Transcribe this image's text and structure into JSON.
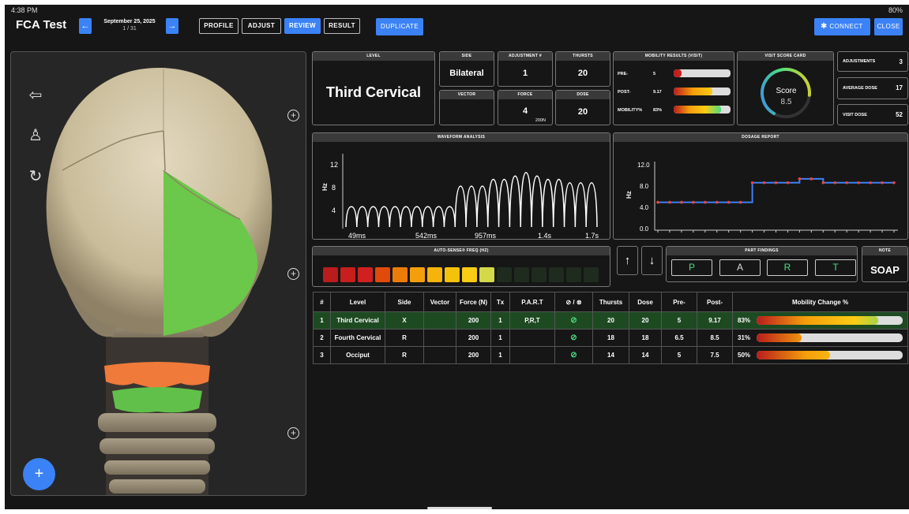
{
  "status": {
    "time": "4:38 PM",
    "battery": "80%"
  },
  "header": {
    "title": "FCA Test",
    "date": "September 25, 2025",
    "date_sub": "1 / 31",
    "tabs": [
      "PROFILE",
      "ADJUST",
      "REVIEW",
      "RESULT"
    ],
    "active_tab": "REVIEW",
    "duplicate_label": "DUPLICATE",
    "connect_label": "CONNECT",
    "close_label": "CLOSE"
  },
  "icons": {
    "prev": "arrow-left-icon",
    "next": "arrow-right-icon",
    "bluetooth": "bluetooth-icon",
    "share": "share-icon",
    "body": "body-icon",
    "refresh": "refresh-icon",
    "add": "plus-icon"
  },
  "level_card": {
    "header": "LEVEL",
    "value": "Third Cervical"
  },
  "side_card": {
    "header": "SIDE",
    "value": "Bilateral"
  },
  "adjustment_card": {
    "header": "ADJUSTMENT #",
    "value": "1"
  },
  "thursts_card": {
    "header": "THURSTS",
    "value": "20"
  },
  "vector_card": {
    "header": "VECTOR",
    "value": ""
  },
  "force_card": {
    "header": "FORCE",
    "value": "4",
    "sub": "200N"
  },
  "dose_card": {
    "header": "DOSE",
    "value": "20"
  },
  "mobility": {
    "header": "MOBILITY RESULTS (VISIT)",
    "rows": [
      {
        "label": "PRE-",
        "value": "5",
        "fraction": 0.14
      },
      {
        "label": "POST-",
        "value": "9.17",
        "fraction": 0.68
      },
      {
        "label": "MOBILITY%",
        "value": "83%",
        "fraction": 0.83
      }
    ]
  },
  "score_card": {
    "header": "VISIT SCORE CARD",
    "label": "Score",
    "value": "8.5",
    "fraction": 0.85
  },
  "stats": [
    {
      "label": "ADJUSTMENTS",
      "value": "3"
    },
    {
      "label": "AVERAGE DOSE",
      "value": "17"
    },
    {
      "label": "VISIT DOSE",
      "value": "52"
    }
  ],
  "waveform": {
    "header": "WAVEFORM ANALYSIS",
    "ylabel": "Hz",
    "yticks": [
      "12",
      "8",
      "4"
    ],
    "xticks": [
      "49ms",
      "542ms",
      "957ms",
      "1.4s",
      "1.7s"
    ]
  },
  "dosage": {
    "header": "DOSAGE REPORT",
    "ylabel": "Hz",
    "yticks": [
      "12.0",
      "8.0",
      "4.0",
      "0.0"
    ]
  },
  "chart_data": [
    {
      "type": "line",
      "title": "WAVEFORM ANALYSIS",
      "ylabel": "Hz",
      "x_ticks": [
        "49ms",
        "542ms",
        "957ms",
        "1.4s",
        "1.7s"
      ],
      "peak_values": [
        5,
        5,
        5,
        5,
        5,
        5,
        5,
        5,
        5,
        5,
        8,
        8,
        8,
        9,
        9,
        9.5,
        10,
        9.5,
        9,
        9,
        8.5,
        8.5,
        8.5
      ],
      "ylim": [
        2,
        13
      ]
    },
    {
      "type": "line",
      "title": "DOSAGE REPORT",
      "ylabel": "Hz",
      "values": [
        5,
        5,
        5,
        5,
        5,
        5,
        5,
        5,
        8.5,
        8.5,
        8.5,
        8.5,
        9.2,
        9.2,
        8.5,
        8.5,
        8.5,
        8.5,
        8.5,
        8.5,
        8.5
      ],
      "ylim": [
        0,
        12
      ]
    }
  ],
  "freq": {
    "header": "AUTO-SENSE® FREQ (HZ)",
    "cells": [
      "#b91c1c",
      "#c81e1e",
      "#d12020",
      "#e04a0a",
      "#ec7c0a",
      "#f59e0b",
      "#f5b30b",
      "#f5c20b",
      "#facc15",
      "#d4d94a",
      "#1f2b1f",
      "#1f2b1f",
      "#1f2b1f",
      "#1f2b1f",
      "#1f2b1f",
      "#1f2b1f"
    ]
  },
  "part_findings": {
    "header": "PART FINDINGS",
    "items": [
      "P",
      "A",
      "R",
      "T"
    ],
    "colors": [
      "#4ade80",
      "#dddddd",
      "#4ade80",
      "#4ade80"
    ]
  },
  "note": {
    "header": "NOTE",
    "value": "SOAP"
  },
  "table": {
    "headers": [
      "#",
      "Level",
      "Side",
      "Vector",
      "Force (N)",
      "Tx",
      "P.A.R.T",
      "⊘ / ⊗",
      "Thursts",
      "Dose",
      "Pre-",
      "Post-",
      "Mobility Change %"
    ],
    "rows": [
      {
        "n": "1",
        "level": "Third Cervical",
        "side": "X",
        "vector": "",
        "force": "200",
        "tx": "1",
        "part": "P,R,T",
        "check": "⊘",
        "thursts": "20",
        "dose": "20",
        "pre": "5",
        "post": "9.17",
        "mob": "83%",
        "mob_fraction": 0.83
      },
      {
        "n": "2",
        "level": "Fourth Cervical",
        "side": "R",
        "vector": "",
        "force": "200",
        "tx": "1",
        "part": "",
        "check": "⊘",
        "thursts": "18",
        "dose": "18",
        "pre": "6.5",
        "post": "8.5",
        "mob": "31%",
        "mob_fraction": 0.31
      },
      {
        "n": "3",
        "level": "Occiput",
        "side": "R",
        "vector": "",
        "force": "200",
        "tx": "1",
        "part": "",
        "check": "⊘",
        "thursts": "14",
        "dose": "14",
        "pre": "5",
        "post": "7.5",
        "mob": "50%",
        "mob_fraction": 0.5
      }
    ]
  }
}
